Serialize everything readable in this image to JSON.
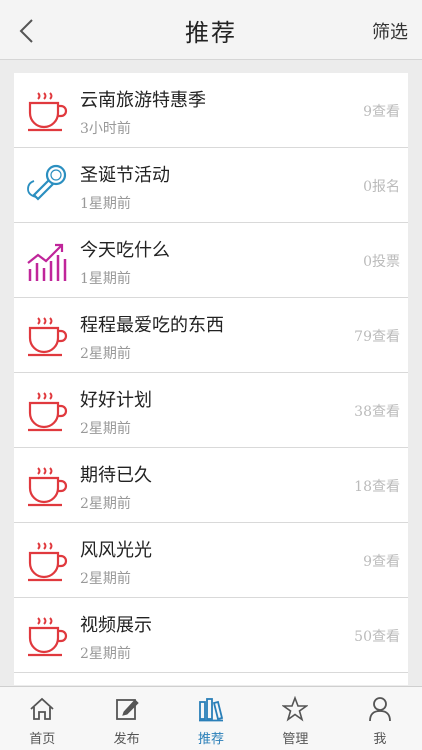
{
  "header": {
    "title": "推荐",
    "filter_label": "筛选"
  },
  "items": [
    {
      "title": "云南旅游特惠季",
      "time": "3小时前",
      "count": "9查看",
      "icon": "coffee-cup-icon"
    },
    {
      "title": "圣诞节活动",
      "time": "1星期前",
      "count": "0报名",
      "icon": "microphone-icon"
    },
    {
      "title": "今天吃什么",
      "time": "1星期前",
      "count": "0投票",
      "icon": "bar-chart-trend-icon"
    },
    {
      "title": "程程最爱吃的东西",
      "time": "2星期前",
      "count": "79查看",
      "icon": "coffee-cup-icon"
    },
    {
      "title": "好好计划",
      "time": "2星期前",
      "count": "38查看",
      "icon": "coffee-cup-icon"
    },
    {
      "title": "期待已久",
      "time": "2星期前",
      "count": "18查看",
      "icon": "coffee-cup-icon"
    },
    {
      "title": "风风光光",
      "time": "2星期前",
      "count": "9查看",
      "icon": "coffee-cup-icon"
    },
    {
      "title": "视频展示",
      "time": "2星期前",
      "count": "50查看",
      "icon": "coffee-cup-icon"
    }
  ],
  "tabbar": {
    "tabs": [
      {
        "label": "首页",
        "icon": "home-icon"
      },
      {
        "label": "发布",
        "icon": "edit-icon"
      },
      {
        "label": "推荐",
        "icon": "books-icon",
        "active": true
      },
      {
        "label": "管理",
        "icon": "star-icon"
      },
      {
        "label": "我",
        "icon": "user-icon"
      }
    ]
  },
  "colors": {
    "cup_red": "#e0393e",
    "mic_blue": "#2b8fc0",
    "chart_magenta": "#c0259a",
    "active_tab": "#2a7fb8"
  }
}
